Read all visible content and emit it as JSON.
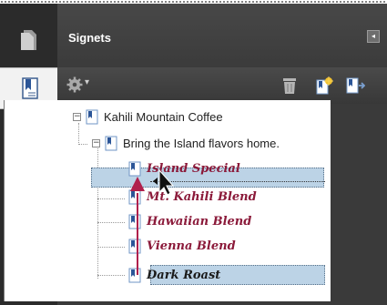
{
  "panel": {
    "title": "Signets",
    "collapse_glyph": "◂"
  },
  "rail": {
    "icons": [
      "pages-icon",
      "bookmarks-icon",
      "layers-icon",
      "signatures-icon",
      "model-tree-icon"
    ],
    "active": "bookmarks-icon"
  },
  "toolbar": {
    "options_icon": "gear-icon",
    "options_glyph": "▾",
    "delete_icon": "trash-icon",
    "new_bookmark_icon": "new-bookmark-icon",
    "bookmark_from_structure_icon": "bookmark-expand-icon"
  },
  "tree": {
    "root": {
      "label": "Kahili Mountain Coffee",
      "expander": "−"
    },
    "child": {
      "label": "Bring the Island flavors home.",
      "expander": "−"
    },
    "items": [
      {
        "label": "Island Special"
      },
      {
        "label": "Mt. Kahili Blend"
      },
      {
        "label": "Hawaiian Blend"
      },
      {
        "label": "Vienna Blend"
      },
      {
        "label": "Dark Roast",
        "selected": true
      }
    ]
  },
  "colors": {
    "accent_label": "#8b1a3a",
    "selection": "#bcd3e6",
    "drag_arrow": "#b0204c"
  }
}
